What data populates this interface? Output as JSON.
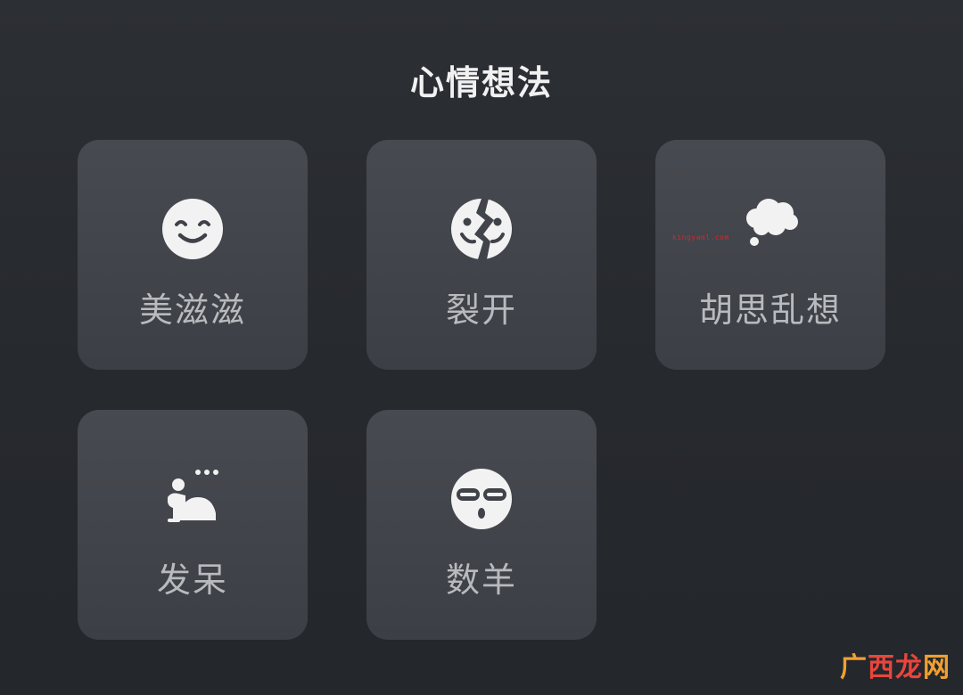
{
  "header": {
    "title": "心情想法"
  },
  "options": [
    {
      "label": "美滋滋",
      "icon": "smiling-face-icon"
    },
    {
      "label": "裂开",
      "icon": "cracked-face-icon"
    },
    {
      "label": "胡思乱想",
      "icon": "thought-cloud-icon"
    },
    {
      "label": "发呆",
      "icon": "daydream-person-icon"
    },
    {
      "label": "数羊",
      "icon": "sleep-mask-face-icon"
    }
  ],
  "watermarks": {
    "small_url": "kingyaml.com",
    "logo_chars": [
      "广",
      "西",
      "龙",
      "网"
    ]
  },
  "colors": {
    "background": "#2a2d32",
    "tile": "#43464c",
    "title": "#f1f1f2",
    "label": "#b9babe",
    "icon": "#f2f2f2"
  }
}
